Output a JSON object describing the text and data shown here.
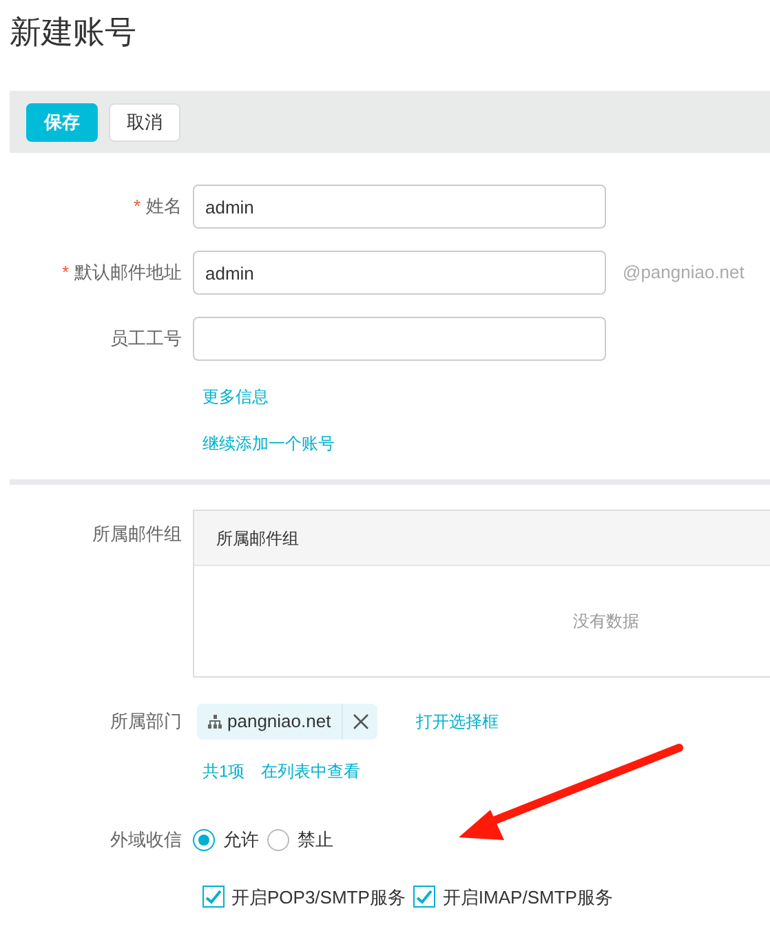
{
  "title": "新建账号",
  "toolbar": {
    "buttons": [
      {
        "label": "保存",
        "kind": "primary"
      },
      {
        "label": "取消",
        "kind": "default"
      }
    ]
  },
  "fields": [
    {
      "label": "姓名",
      "required": true,
      "value": "admin"
    },
    {
      "label": "默认邮件地址",
      "required": true,
      "value": "admin",
      "suffix": "@pangniao.net"
    },
    {
      "label": "员工工号",
      "required": false
    }
  ],
  "required_mark": "*",
  "links": [
    "更多信息",
    "继续添加一个账号"
  ],
  "mail_group": {
    "label": "所属邮件组",
    "column": "所属邮件组",
    "empty_text": "没有数据"
  },
  "department": {
    "label": "所属部门",
    "tag": "pangniao.net",
    "open_link": "打开选择框",
    "count_link": "共1项",
    "view_link": "在列表中查看"
  },
  "external_mail": {
    "label": "外域收信",
    "options": [
      {
        "label": "允许",
        "selected": true
      },
      {
        "label": "禁止",
        "selected": false
      }
    ]
  },
  "services": [
    {
      "label": "开启POP3/SMTP服务",
      "checked": true
    },
    {
      "label": "开启IMAP/SMTP服务",
      "checked": true
    }
  ]
}
